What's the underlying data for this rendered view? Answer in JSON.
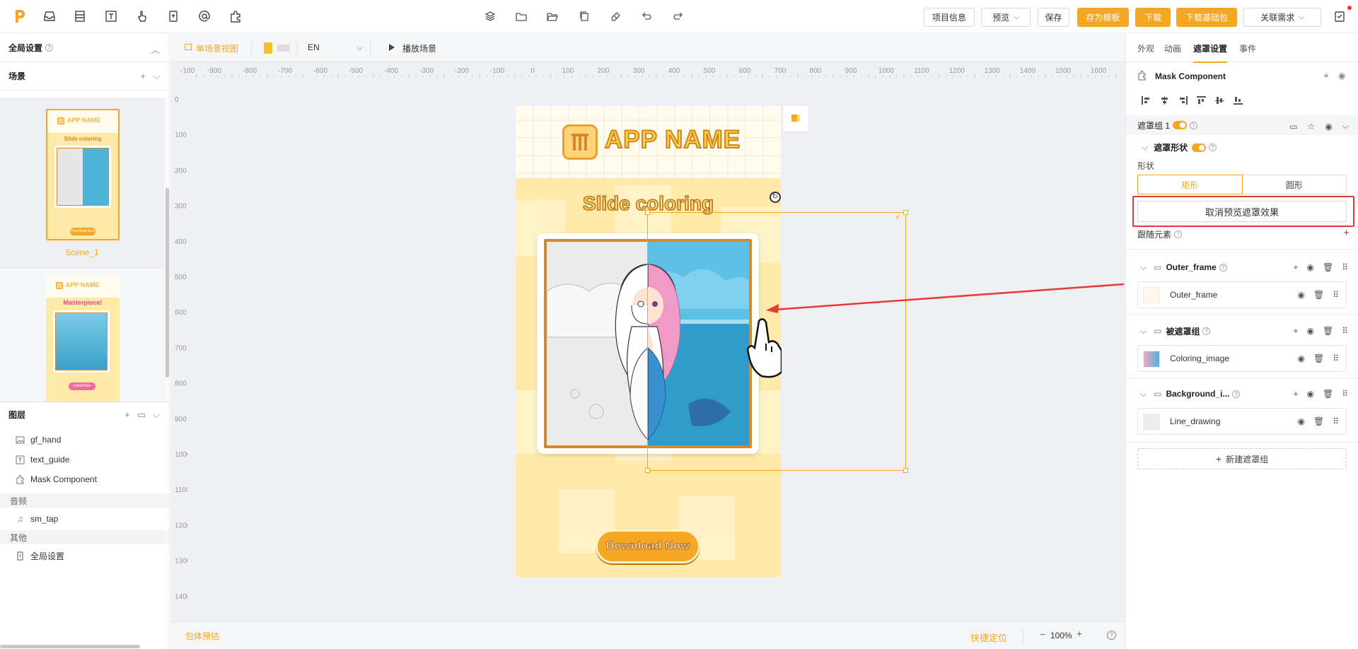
{
  "topbar": {
    "project_info": "项目信息",
    "preview": "预览",
    "save": "保存",
    "save_template": "存为模板",
    "download": "下载",
    "download_base": "下载基础包",
    "related": "关联需求"
  },
  "left": {
    "global_settings": "全局设置",
    "scenes_title": "场景",
    "scenes": [
      {
        "label": "Scene_1",
        "app_name": "APP NAME",
        "title": "Slide coloring",
        "button": "Download Now"
      },
      {
        "label": "",
        "app_name": "APP NAME",
        "title": "Masterpiece!",
        "button": "Install Now"
      }
    ],
    "layers_title": "图层",
    "layers": [
      {
        "label": "gf_hand"
      },
      {
        "label": "text_guide"
      },
      {
        "label": "Mask Component"
      }
    ],
    "audio_category": "音频",
    "audio_items": [
      {
        "label": "sm_tap"
      }
    ],
    "other_category": "其他",
    "other_items": [
      {
        "label": "全局设置"
      }
    ]
  },
  "canvas": {
    "view_mode": "单场景视图",
    "language": "EN",
    "play_scene": "播放场景",
    "ruler_top_labels": [
      "-100",
      "-900",
      "-800",
      "-700",
      "-600",
      "-500",
      "-400",
      "-300",
      "-200",
      "-100",
      "0",
      "100",
      "200",
      "300",
      "400",
      "500",
      "600",
      "700",
      "800",
      "900",
      "1000",
      "1100",
      "1200",
      "1300",
      "1400",
      "1500",
      "1600",
      "17"
    ],
    "ruler_left_labels": [
      "0",
      "100",
      "200",
      "300",
      "400",
      "500",
      "600",
      "700",
      "800",
      "900",
      "1000",
      "1100",
      "1200",
      "1300",
      "1400"
    ],
    "package_estimate": "包体预估",
    "quick_locate": "快捷定位",
    "zoom": "100%",
    "game": {
      "app_name": "APP NAME",
      "title": "Slide coloring",
      "download_button": "Download Now"
    }
  },
  "right": {
    "tabs": [
      "外观",
      "动画",
      "遮罩设置",
      "事件"
    ],
    "active_tab": 2,
    "component_name": "Mask Component",
    "mask_group_label": "遮罩组 1",
    "mask_shape_label": "遮罩形状",
    "shape_label": "形状",
    "shape_options": [
      "矩形",
      "圆形"
    ],
    "cancel_preview": "取消预览遮罩效果",
    "follow_element": "跟随元素",
    "groups": [
      {
        "name": "Outer_frame",
        "item": "Outer_frame"
      },
      {
        "name": "被遮罩组",
        "item": "Coloring_image"
      },
      {
        "name": "Background_i...",
        "item": "Line_drawing"
      }
    ],
    "new_mask_group": "新建遮罩组"
  },
  "colors": {
    "accent": "#f5a623",
    "highlight_box": "#e53935"
  }
}
